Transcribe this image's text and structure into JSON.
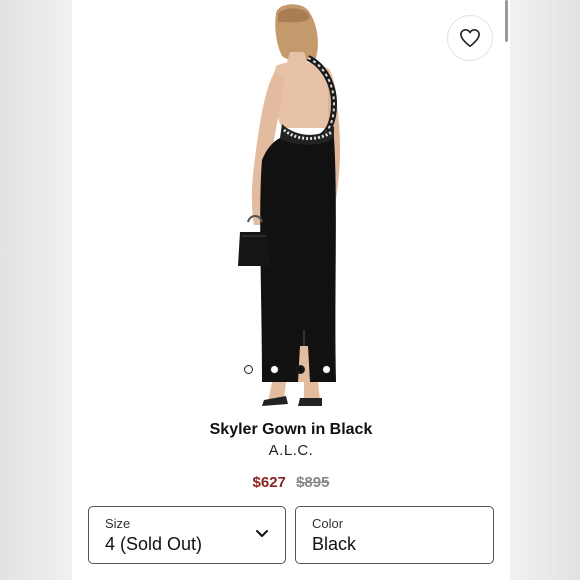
{
  "product": {
    "title": "Skyler Gown in Black",
    "brand": "A.L.C.",
    "sale_price": "$627",
    "original_price": "$895"
  },
  "gallery": {
    "image_count": 4,
    "active_index": 2
  },
  "size_select": {
    "label": "Size",
    "value": "4 (Sold Out)"
  },
  "color_select": {
    "label": "Color",
    "value": "Black"
  },
  "icons": {
    "favorite": "heart-icon",
    "dropdown": "chevron-down-icon"
  },
  "colors": {
    "sale_price": "#8b2323",
    "original_price": "#888888",
    "dress": "#111111"
  }
}
